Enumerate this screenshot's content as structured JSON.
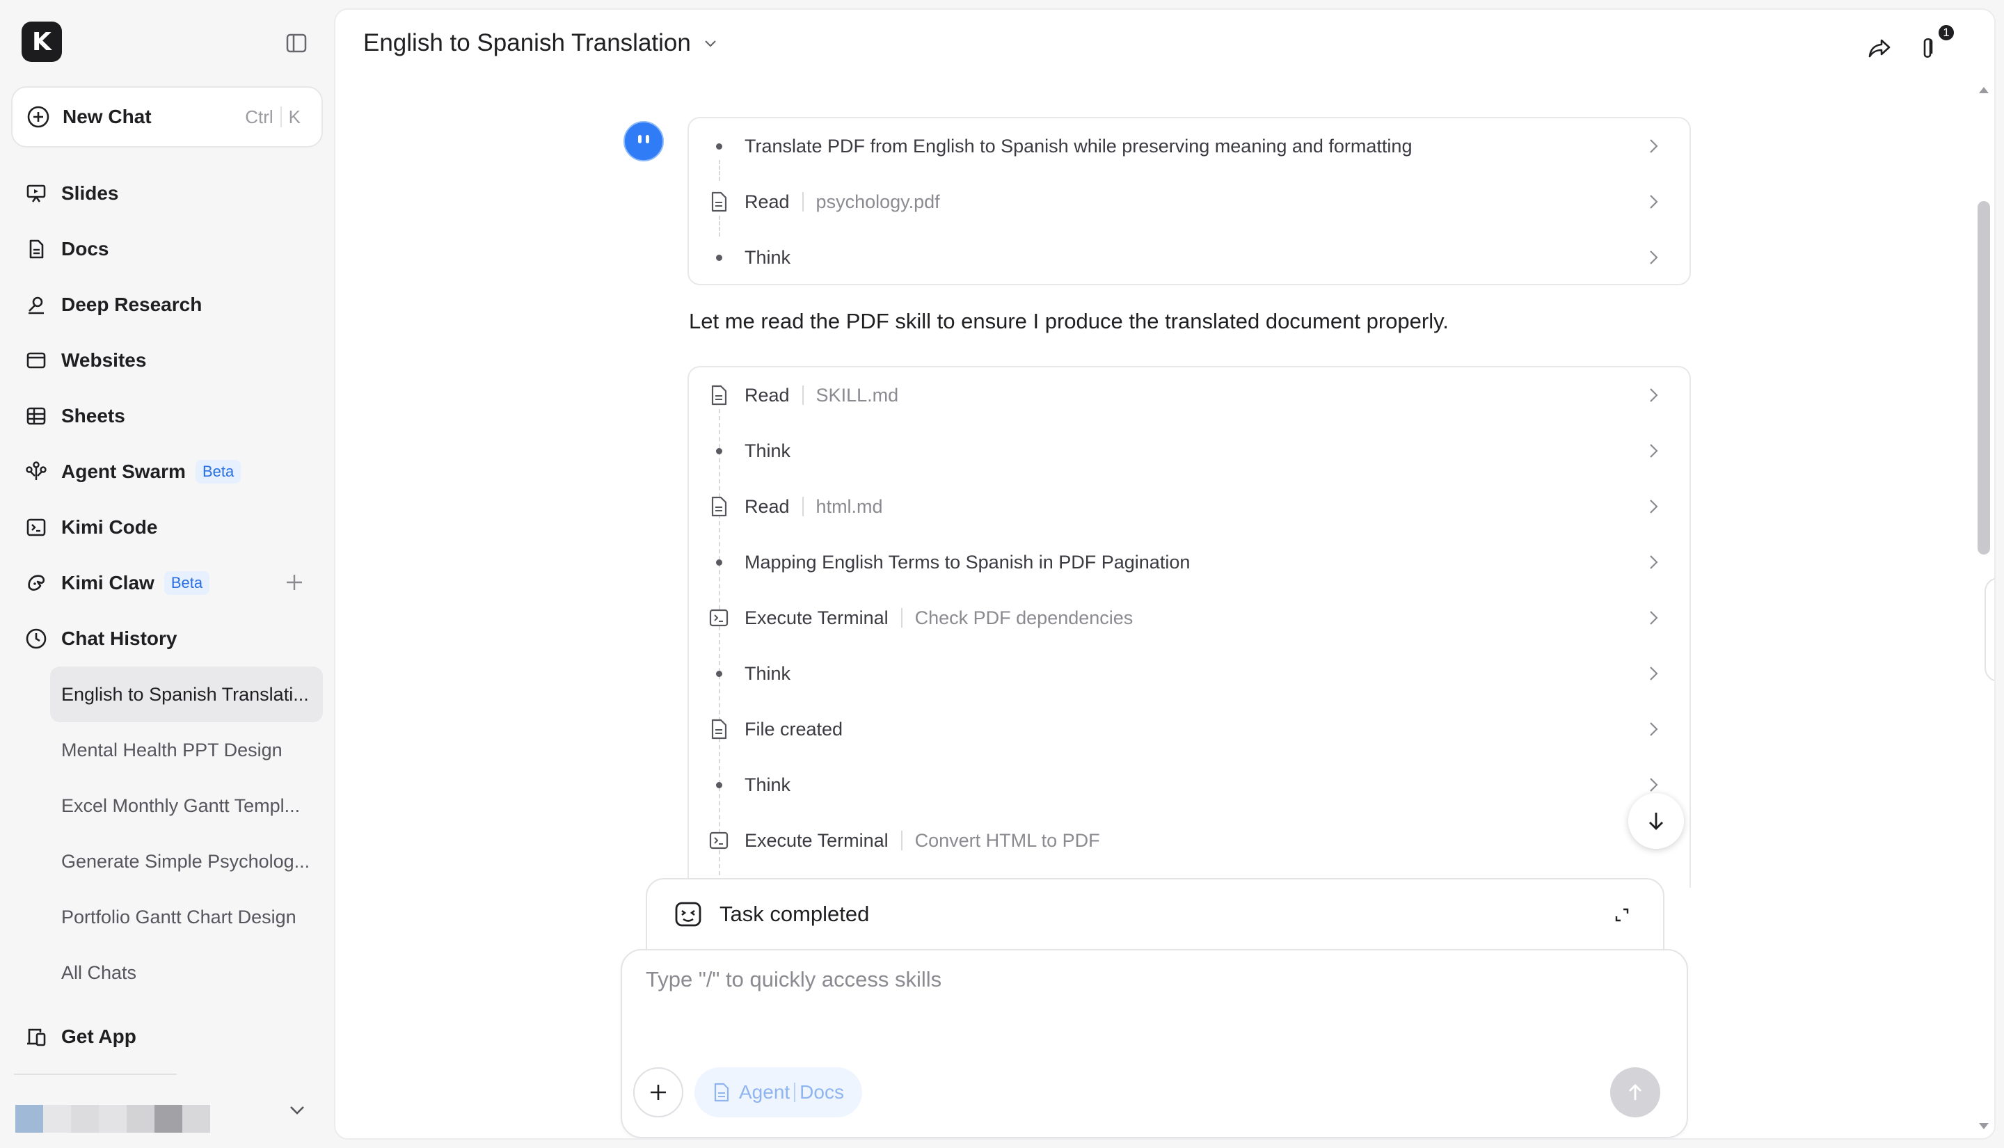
{
  "app": {
    "logo_letter": "K"
  },
  "sidebar": {
    "new_chat": {
      "label": "New Chat",
      "shortcut_mod": "Ctrl",
      "shortcut_key": "K"
    },
    "nav": [
      {
        "label": "Slides",
        "icon": "slides-icon"
      },
      {
        "label": "Docs",
        "icon": "docs-icon"
      },
      {
        "label": "Deep Research",
        "icon": "deep-research-icon"
      },
      {
        "label": "Websites",
        "icon": "websites-icon"
      },
      {
        "label": "Sheets",
        "icon": "sheets-icon"
      },
      {
        "label": "Agent Swarm",
        "icon": "agent-swarm-icon",
        "badge": "Beta"
      },
      {
        "label": "Kimi Code",
        "icon": "terminal-icon"
      },
      {
        "label": "Kimi Claw",
        "icon": "claw-icon",
        "badge": "Beta"
      },
      {
        "label": "Chat History",
        "icon": "clock-icon"
      }
    ],
    "history": [
      "English to Spanish Translati...",
      "Mental Health PPT Design",
      "Excel Monthly Gantt Templ...",
      "Generate Simple Psycholog...",
      "Portfolio Gantt Chart Design",
      "All Chats"
    ],
    "get_app": "Get App"
  },
  "main": {
    "title": "English to Spanish Translation",
    "attachment_count": "1",
    "card1": [
      {
        "label": "Translate PDF from English to Spanish while preserving meaning and formatting",
        "type": "dot"
      },
      {
        "label": "Read",
        "detail": "psychology.pdf",
        "type": "file"
      },
      {
        "label": "Think",
        "type": "dot"
      }
    ],
    "assistant_text": "Let me read the PDF skill to ensure I produce the translated document properly.",
    "card2": [
      {
        "label": "Read",
        "detail": "SKILL.md",
        "type": "file"
      },
      {
        "label": "Think",
        "type": "dot"
      },
      {
        "label": "Read",
        "detail": "html.md",
        "type": "file"
      },
      {
        "label": "Mapping English Terms to Spanish in PDF Pagination",
        "type": "dot"
      },
      {
        "label": "Execute Terminal",
        "detail": "Check PDF dependencies",
        "type": "terminal"
      },
      {
        "label": "Think",
        "type": "dot"
      },
      {
        "label": "File created",
        "type": "file"
      },
      {
        "label": "Think",
        "type": "dot"
      },
      {
        "label": "Execute Terminal",
        "detail": "Convert HTML to PDF",
        "type": "terminal"
      }
    ],
    "task_status": "Task completed",
    "input": {
      "placeholder": "Type \"/\" to quickly access skills",
      "value": "",
      "chip_agent": "Agent",
      "chip_docs": "Docs"
    }
  },
  "colors": {
    "accent": "#2a6fe0",
    "avatar": "#2f7cf6",
    "logo_bg": "#1c1c1e"
  }
}
